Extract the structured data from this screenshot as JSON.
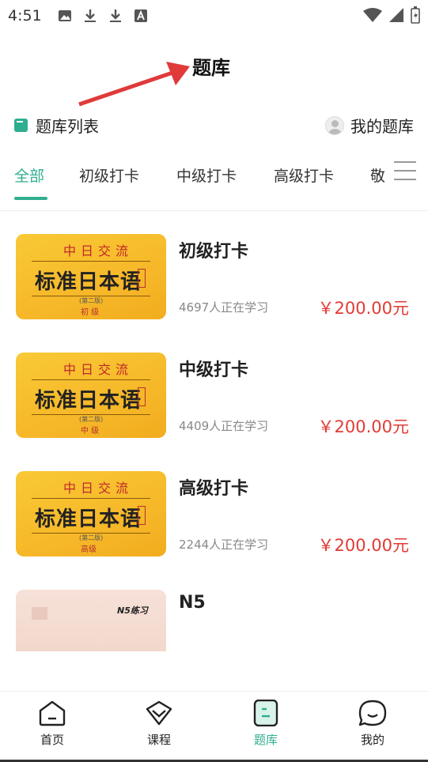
{
  "status_bar": {
    "time": "4:51",
    "left_icons": [
      "image-icon",
      "download-icon",
      "download-icon",
      "text-a-icon"
    ],
    "right_icons": [
      "wifi-icon",
      "signal-icon",
      "battery-icon"
    ]
  },
  "header": {
    "title": "题库"
  },
  "section": {
    "list_label": "题库列表",
    "my_label": "我的题库"
  },
  "tabs": {
    "items": [
      "全部",
      "初级打卡",
      "中级打卡",
      "高级打卡",
      "敬"
    ],
    "active_index": 0
  },
  "courses": [
    {
      "name": "初级打卡",
      "learners": "4697人正在学习",
      "price": "￥200.00元",
      "cover": {
        "brand": "中日交流",
        "title": "标准日本语",
        "edition": "(第二版)",
        "level": "初 级"
      }
    },
    {
      "name": "中级打卡",
      "learners": "4409人正在学习",
      "price": "￥200.00元",
      "cover": {
        "brand": "中日交流",
        "title": "标准日本语",
        "edition": "(第二版)",
        "level": "中 级"
      }
    },
    {
      "name": "高级打卡",
      "learners": "2244人正在学习",
      "price": "￥200.00元",
      "cover": {
        "brand": "中日交流",
        "title": "标准日本语",
        "edition": "(第二版)",
        "level": "高级"
      }
    },
    {
      "name": "N5",
      "cover": {
        "text": "N5练习"
      }
    }
  ],
  "bottom_nav": [
    {
      "label": "首页",
      "icon": "home-icon",
      "active": false
    },
    {
      "label": "课程",
      "icon": "course-icon",
      "active": false
    },
    {
      "label": "题库",
      "icon": "question-bank-icon",
      "active": true
    },
    {
      "label": "我的",
      "icon": "profile-icon",
      "active": false
    }
  ],
  "colors": {
    "accent": "#2fae8f",
    "price": "#e23b35",
    "annotation_arrow": "#e03a3a"
  }
}
